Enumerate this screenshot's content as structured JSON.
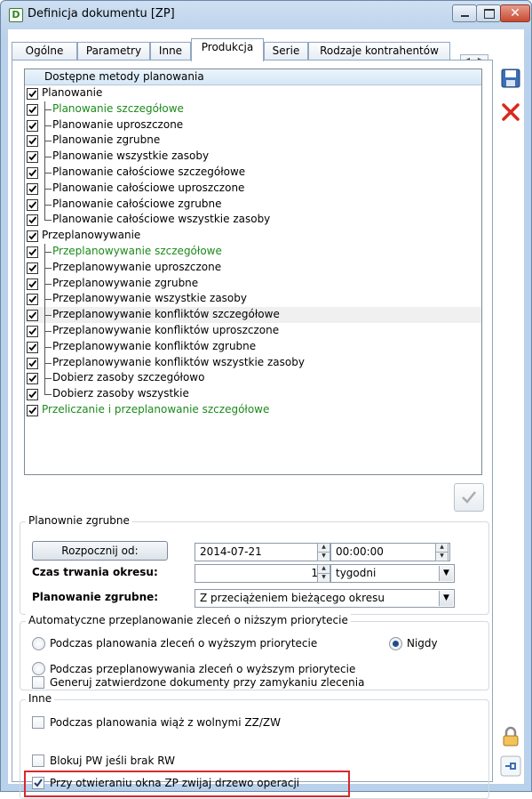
{
  "window": {
    "title": "Definicja dokumentu [ZP]",
    "app_icon_letter": "D"
  },
  "tabs": [
    {
      "label": "Ogólne",
      "active": false
    },
    {
      "label": "Parametry",
      "active": false
    },
    {
      "label": "Inne",
      "active": false
    },
    {
      "label": "Produkcja",
      "active": true
    },
    {
      "label": "Serie",
      "active": false
    },
    {
      "label": "Rodzaje kontrahentów",
      "active": false
    }
  ],
  "tree": {
    "header": "Dostępne metody planowania",
    "rows": [
      {
        "label": "Planowanie",
        "checked": true,
        "level": 0,
        "color": "black"
      },
      {
        "label": "Planowanie szczegółowe",
        "checked": true,
        "level": 1,
        "color": "green"
      },
      {
        "label": "Planowanie uproszczone",
        "checked": true,
        "level": 1,
        "color": "black"
      },
      {
        "label": "Planowanie zgrubne",
        "checked": true,
        "level": 1,
        "color": "black"
      },
      {
        "label": "Planowanie wszystkie zasoby",
        "checked": true,
        "level": 1,
        "color": "black"
      },
      {
        "label": "Planowanie całościowe szczegółowe",
        "checked": true,
        "level": 1,
        "color": "black"
      },
      {
        "label": "Planowanie całościowe uproszczone",
        "checked": true,
        "level": 1,
        "color": "black"
      },
      {
        "label": "Planowanie całościowe zgrubne",
        "checked": true,
        "level": 1,
        "color": "black"
      },
      {
        "label": "Planowanie całościowe wszystkie zasoby",
        "checked": true,
        "level": 1,
        "color": "black"
      },
      {
        "label": "Przeplanowywanie",
        "checked": true,
        "level": 0,
        "color": "black"
      },
      {
        "label": "Przeplanowywanie szczegółowe",
        "checked": true,
        "level": 1,
        "color": "green"
      },
      {
        "label": "Przeplanowywanie uproszczone",
        "checked": true,
        "level": 1,
        "color": "black"
      },
      {
        "label": "Przeplanowywanie zgrubne",
        "checked": true,
        "level": 1,
        "color": "black"
      },
      {
        "label": "Przeplanowywanie wszystkie zasoby",
        "checked": true,
        "level": 1,
        "color": "black"
      },
      {
        "label": "Przeplanowywanie konfliktów szczegółowe",
        "checked": true,
        "level": 1,
        "color": "black",
        "highlighted": true
      },
      {
        "label": "Przeplanowywanie konfliktów uproszczone",
        "checked": true,
        "level": 1,
        "color": "black"
      },
      {
        "label": "Przeplanowywanie konfliktów zgrubne",
        "checked": true,
        "level": 1,
        "color": "black"
      },
      {
        "label": "Przeplanowywanie konfliktów wszystkie zasoby",
        "checked": true,
        "level": 1,
        "color": "black"
      },
      {
        "label": "Dobierz zasoby szczegółowo",
        "checked": true,
        "level": 1,
        "color": "black"
      },
      {
        "label": "Dobierz zasoby wszystkie",
        "checked": true,
        "level": 1,
        "color": "black"
      },
      {
        "label": "Przeliczanie i przeplanowanie szczegółowe",
        "checked": true,
        "level": 0,
        "color": "green"
      }
    ]
  },
  "planowanie_zgrubne": {
    "group_label": "Planownie zgrubne",
    "start_button": "Rozpocznij od:",
    "start_date": "2014-07-21",
    "start_time": "00:00:00",
    "duration_label": "Czas trwania okresu:",
    "duration_value": "1",
    "duration_unit": "tygodni",
    "mode_label": "Planowanie zgrubne:",
    "mode_value": "Z przeciążeniem bieżącego okresu"
  },
  "auto_replan": {
    "group_label": "Automatyczne przeplanowanie zleceń o niższym priorytecie",
    "opt_planning": "Podczas planowania zleceń o wyższym priorytecie",
    "opt_never": "Nigdy",
    "opt_replanning": "Podczas przeplanowywania zleceń o wyższym priorytecie",
    "selected": "Nigdy"
  },
  "generate_confirmed": {
    "label": "Generuj zatwierdzone dokumenty przy zamykaniu zlecenia",
    "checked": false
  },
  "inne": {
    "group_label": "Inne",
    "bind_zz": {
      "label": "Podczas planowania wiąż z wolnymi ZZ/ZW",
      "checked": false
    },
    "block_pw": {
      "label": "Blokuj PW jeśli brak RW",
      "checked": false
    },
    "collapse_tree": {
      "label": "Przy otwieraniu okna ZP zwijaj drzewo operacji",
      "checked": true
    }
  },
  "colors": {
    "accent_green": "#1b8a1b",
    "highlight_red": "#d9282d",
    "close_red": "#c84a32"
  }
}
